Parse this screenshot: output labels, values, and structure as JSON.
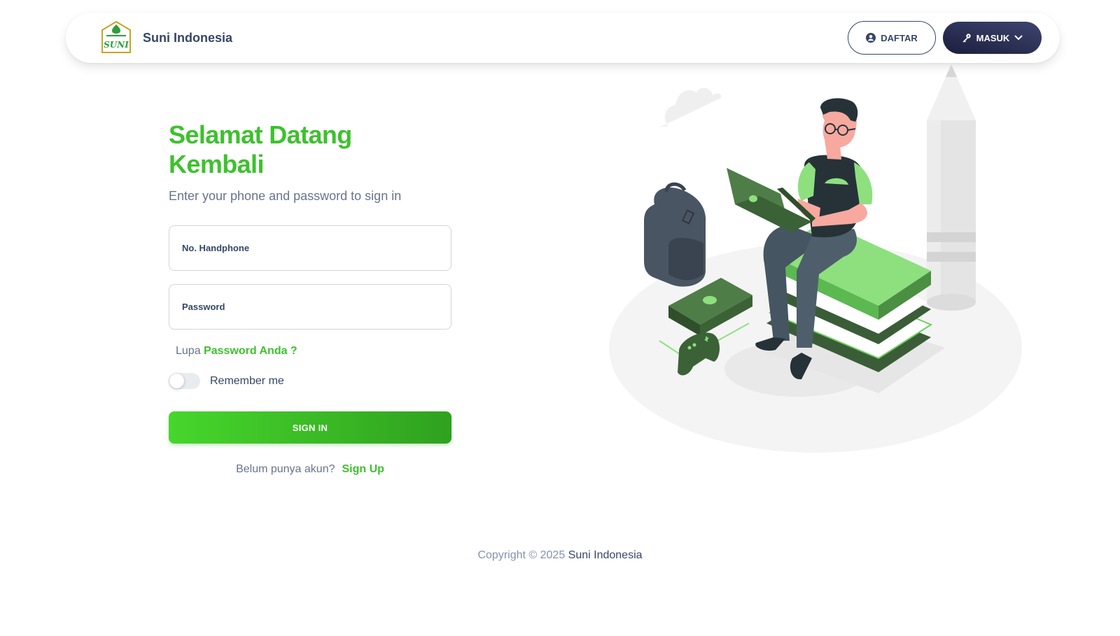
{
  "header": {
    "brand_name": "Suni Indonesia",
    "logo_text": "SUNI",
    "daftar_label": "DAFTAR",
    "masuk_label": "MASUK"
  },
  "login": {
    "title": "Selamat Datang Kembali",
    "subtitle": "Enter your phone and password to sign in",
    "phone_placeholder": "No. Handphone",
    "password_placeholder": "Password",
    "forgot_prefix": "Lupa",
    "forgot_link": "Password Anda ?",
    "remember_label": "Remember me",
    "remember_checked": false,
    "signin_label": "SIGN IN",
    "signup_prompt": "Belum punya akun?",
    "signup_link": "Sign Up"
  },
  "footer": {
    "copyright": "Copyright © 2025",
    "company": "Suni Indonesia"
  },
  "icons": {
    "logo": "suni-logo-icon",
    "daftar": "user-circle-icon",
    "masuk": "key-icon",
    "dropdown": "chevron-down-icon"
  },
  "colors": {
    "primary_green": "#3ec12e",
    "dark_navy": "#1a1f3d",
    "text": "#344767",
    "muted": "#67748e"
  }
}
